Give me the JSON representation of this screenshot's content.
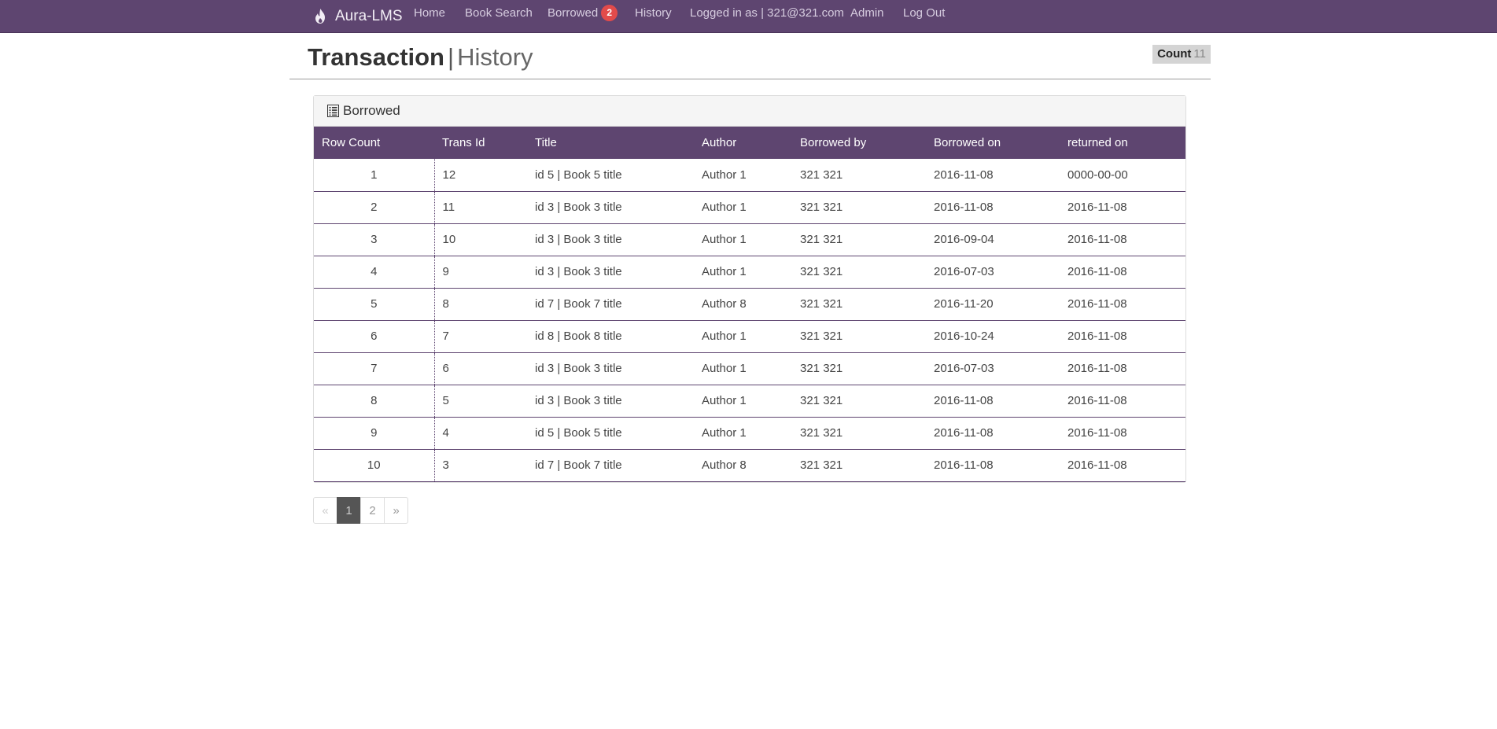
{
  "nav": {
    "brand": "Aura-LMS",
    "brand_icon": "flame-icon",
    "home": "Home",
    "book_search": "Book Search",
    "borrowed": "Borrowed",
    "borrowed_count": "2",
    "history": "History",
    "logged_in": "Logged in as | 321@321.com",
    "admin": "Admin",
    "logout": "Log Out"
  },
  "header": {
    "title_strong": "Transaction",
    "title_sep": "|",
    "title_light": "History",
    "count_label": "Count",
    "count_value": "11"
  },
  "panel": {
    "title": "Borrowed",
    "icon": "list-icon"
  },
  "table": {
    "columns": [
      "Row Count",
      "Trans Id",
      "Title",
      "Author",
      "Borrowed by",
      "Borrowed on",
      "returned on"
    ],
    "rows": [
      [
        "1",
        "12",
        "id 5 | Book 5 title",
        "Author 1",
        "321 321",
        "2016-11-08",
        "0000-00-00"
      ],
      [
        "2",
        "11",
        "id 3 | Book 3 title",
        "Author 1",
        "321 321",
        "2016-11-08",
        "2016-11-08"
      ],
      [
        "3",
        "10",
        "id 3 | Book 3 title",
        "Author 1",
        "321 321",
        "2016-09-04",
        "2016-11-08"
      ],
      [
        "4",
        "9",
        "id 3 | Book 3 title",
        "Author 1",
        "321 321",
        "2016-07-03",
        "2016-11-08"
      ],
      [
        "5",
        "8",
        "id 7 | Book 7 title",
        "Author 8",
        "321 321",
        "2016-11-20",
        "2016-11-08"
      ],
      [
        "6",
        "7",
        "id 8 | Book 8 title",
        "Author 1",
        "321 321",
        "2016-10-24",
        "2016-11-08"
      ],
      [
        "7",
        "6",
        "id 3 | Book 3 title",
        "Author 1",
        "321 321",
        "2016-07-03",
        "2016-11-08"
      ],
      [
        "8",
        "5",
        "id 3 | Book 3 title",
        "Author 1",
        "321 321",
        "2016-11-08",
        "2016-11-08"
      ],
      [
        "9",
        "4",
        "id 5 | Book 5 title",
        "Author 1",
        "321 321",
        "2016-11-08",
        "2016-11-08"
      ],
      [
        "10",
        "3",
        "id 7 | Book 7 title",
        "Author 8",
        "321 321",
        "2016-11-08",
        "2016-11-08"
      ]
    ]
  },
  "pagination": {
    "prev": "«",
    "pages": [
      "1",
      "2"
    ],
    "active_page": "1",
    "next": "»"
  },
  "colors": {
    "navbar": "#5e4570",
    "table_header": "#5e4570",
    "badge": "#e24b4b",
    "active_page": "#555555"
  }
}
